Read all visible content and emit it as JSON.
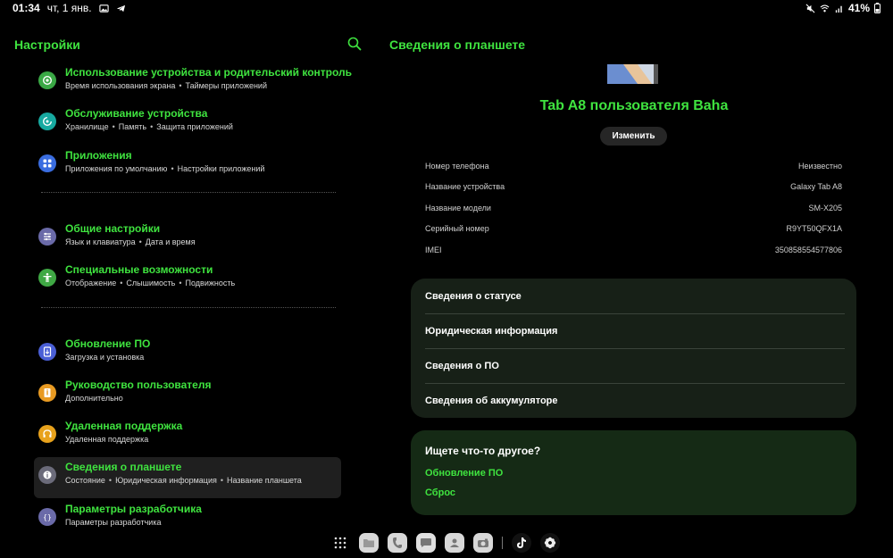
{
  "status_bar": {
    "time": "01:34",
    "date": "чт, 1 янв.",
    "battery": "41%"
  },
  "left": {
    "title": "Настройки",
    "groups": [
      [
        {
          "title": "Использование устройства и родительский контроль",
          "subs": [
            "Время использования экрана",
            "Таймеры приложений"
          ],
          "icon": "digital-wellbeing-icon",
          "color": "#3aa845"
        },
        {
          "title": "Обслуживание устройства",
          "subs": [
            "Хранилище",
            "Память",
            "Защита приложений"
          ],
          "icon": "device-care-icon",
          "color": "#17a9a0"
        },
        {
          "title": "Приложения",
          "subs": [
            "Приложения по умолчанию",
            "Настройки приложений"
          ],
          "icon": "apps-icon",
          "color": "#3a6de0"
        }
      ],
      [
        {
          "title": "Общие настройки",
          "subs": [
            "Язык и клавиатура",
            "Дата и время"
          ],
          "icon": "general-management-icon",
          "color": "#6a6aa8"
        },
        {
          "title": "Специальные возможности",
          "subs": [
            "Отображение",
            "Слышимость",
            "Подвижность"
          ],
          "icon": "accessibility-icon",
          "color": "#3fa844"
        }
      ],
      [
        {
          "title": "Обновление ПО",
          "subs": [
            "Загрузка и установка"
          ],
          "icon": "software-update-icon",
          "color": "#4a5fd6"
        },
        {
          "title": "Руководство пользователя",
          "subs": [
            "Дополнительно"
          ],
          "icon": "user-manual-icon",
          "color": "#e89a22"
        },
        {
          "title": "Удаленная поддержка",
          "subs": [
            "Удаленная поддержка"
          ],
          "icon": "remote-support-icon",
          "color": "#e8a21c"
        },
        {
          "title": "Сведения о планшете",
          "subs": [
            "Состояние",
            "Юридическая информация",
            "Название планшета"
          ],
          "icon": "about-tablet-icon",
          "color": "#6b6b7a",
          "active": true
        },
        {
          "title": "Параметры разработчика",
          "subs": [
            "Параметры разработчика"
          ],
          "icon": "developer-options-icon",
          "color": "#6a6aa8"
        }
      ]
    ]
  },
  "right": {
    "title": "Сведения о планшете",
    "device_name": "Tab A8 пользователя Baha",
    "edit_label": "Изменить",
    "info": [
      {
        "label": "Номер телефона",
        "value": "Неизвестно"
      },
      {
        "label": "Название устройства",
        "value": "Galaxy Tab A8"
      },
      {
        "label": "Название модели",
        "value": "SM-X205"
      },
      {
        "label": "Серийный номер",
        "value": "R9YT50QFX1A"
      },
      {
        "label": "IMEI",
        "value": "350858554577806"
      }
    ],
    "sections": [
      "Сведения о статусе",
      "Юридическая информация",
      "Сведения о ПО",
      "Сведения об аккумуляторе"
    ],
    "looking_for": {
      "title": "Ищете что-то другое?",
      "links": [
        "Обновление ПО",
        "Сброс"
      ]
    }
  },
  "dock": {
    "items": [
      "app-drawer-icon",
      "my-files-icon",
      "phone-icon",
      "messages-icon",
      "contacts-icon",
      "camera-icon",
      "tiktok-icon",
      "flower-app-icon"
    ]
  },
  "colors": {
    "accent": "#3fe33f",
    "background": "#000000",
    "card": "#172017",
    "card_highlight": "#152a15",
    "active_item": "#1f1f1f"
  }
}
